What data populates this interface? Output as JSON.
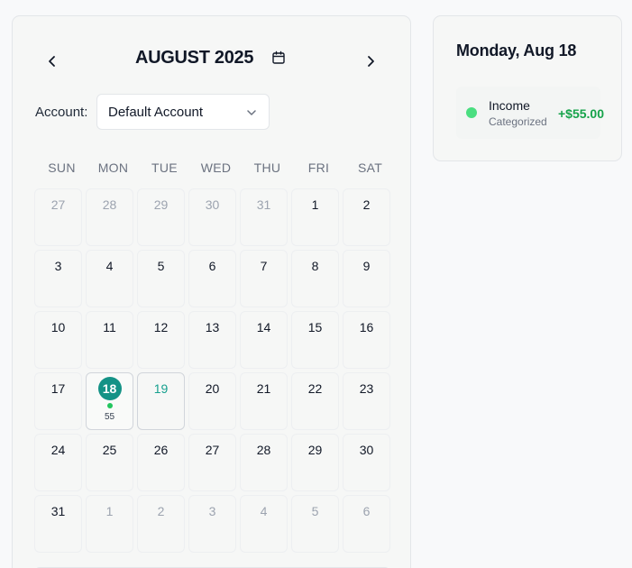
{
  "calendar": {
    "month_title": "AUGUST 2025",
    "prev_icon": "chevron-left-icon",
    "next_icon": "chevron-right-icon",
    "picker_icon": "calendar-icon",
    "account_label": "Account:",
    "account_value": "Default Account",
    "weekdays": [
      "SUN",
      "MON",
      "TUE",
      "WED",
      "THU",
      "FRI",
      "SAT"
    ],
    "days": [
      {
        "n": "27",
        "muted": true
      },
      {
        "n": "28",
        "muted": true
      },
      {
        "n": "29",
        "muted": true
      },
      {
        "n": "30",
        "muted": true
      },
      {
        "n": "31",
        "muted": true
      },
      {
        "n": "1"
      },
      {
        "n": "2"
      },
      {
        "n": "3"
      },
      {
        "n": "4"
      },
      {
        "n": "5"
      },
      {
        "n": "6"
      },
      {
        "n": "7"
      },
      {
        "n": "8"
      },
      {
        "n": "9"
      },
      {
        "n": "10"
      },
      {
        "n": "11"
      },
      {
        "n": "12"
      },
      {
        "n": "13"
      },
      {
        "n": "14"
      },
      {
        "n": "15"
      },
      {
        "n": "16"
      },
      {
        "n": "17"
      },
      {
        "n": "18",
        "selected": true,
        "dot": true,
        "amount": "55"
      },
      {
        "n": "19",
        "today": true
      },
      {
        "n": "20"
      },
      {
        "n": "21"
      },
      {
        "n": "22"
      },
      {
        "n": "23"
      },
      {
        "n": "24"
      },
      {
        "n": "25"
      },
      {
        "n": "26"
      },
      {
        "n": "27"
      },
      {
        "n": "28"
      },
      {
        "n": "29"
      },
      {
        "n": "30"
      },
      {
        "n": "31"
      },
      {
        "n": "1",
        "muted": true
      },
      {
        "n": "2",
        "muted": true
      },
      {
        "n": "3",
        "muted": true
      },
      {
        "n": "4",
        "muted": true
      },
      {
        "n": "5",
        "muted": true
      },
      {
        "n": "6",
        "muted": true
      }
    ]
  },
  "detail": {
    "title": "Monday, Aug 18",
    "transactions": [
      {
        "name": "Income",
        "status": "Categorized",
        "amount": "+$55.00",
        "color": "#4ade80"
      }
    ]
  },
  "colors": {
    "accent": "#149286",
    "income_dot": "#22c55e",
    "income_amount": "#16a34a"
  }
}
